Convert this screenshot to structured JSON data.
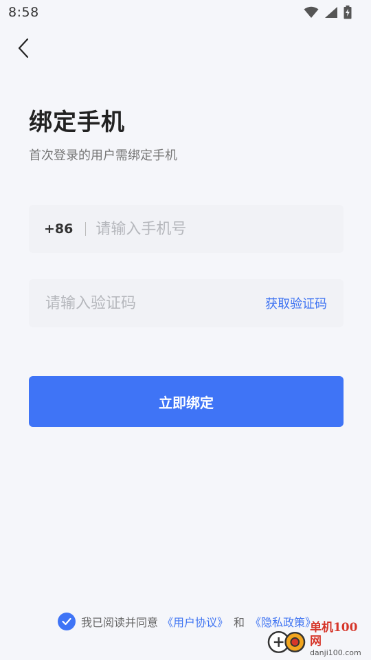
{
  "status_bar": {
    "time": "8:58",
    "icons": [
      "wifi-icon",
      "signal-icon",
      "battery-charging-icon"
    ]
  },
  "nav": {
    "back_icon": "chevron-left-icon"
  },
  "header": {
    "title": "绑定手机",
    "subtitle": "首次登录的用户需绑定手机"
  },
  "phone_field": {
    "country_code": "+86",
    "value": "",
    "placeholder": "请输入手机号"
  },
  "code_field": {
    "value": "",
    "placeholder": "请输入验证码",
    "get_code_label": "获取验证码"
  },
  "submit": {
    "label": "立即绑定"
  },
  "agreement": {
    "checked": true,
    "prefix": "我已阅读并同意",
    "user_agreement": "《用户协议》",
    "conjunction": "和",
    "privacy_policy": "《隐私政策》"
  },
  "watermark": {
    "site_name": "单机100网",
    "domain": "danji100.com"
  },
  "colors": {
    "accent": "#3f74f6",
    "background": "#f5f6fa",
    "field_background": "#f1f2f6",
    "watermark_red": "#d6362a"
  }
}
